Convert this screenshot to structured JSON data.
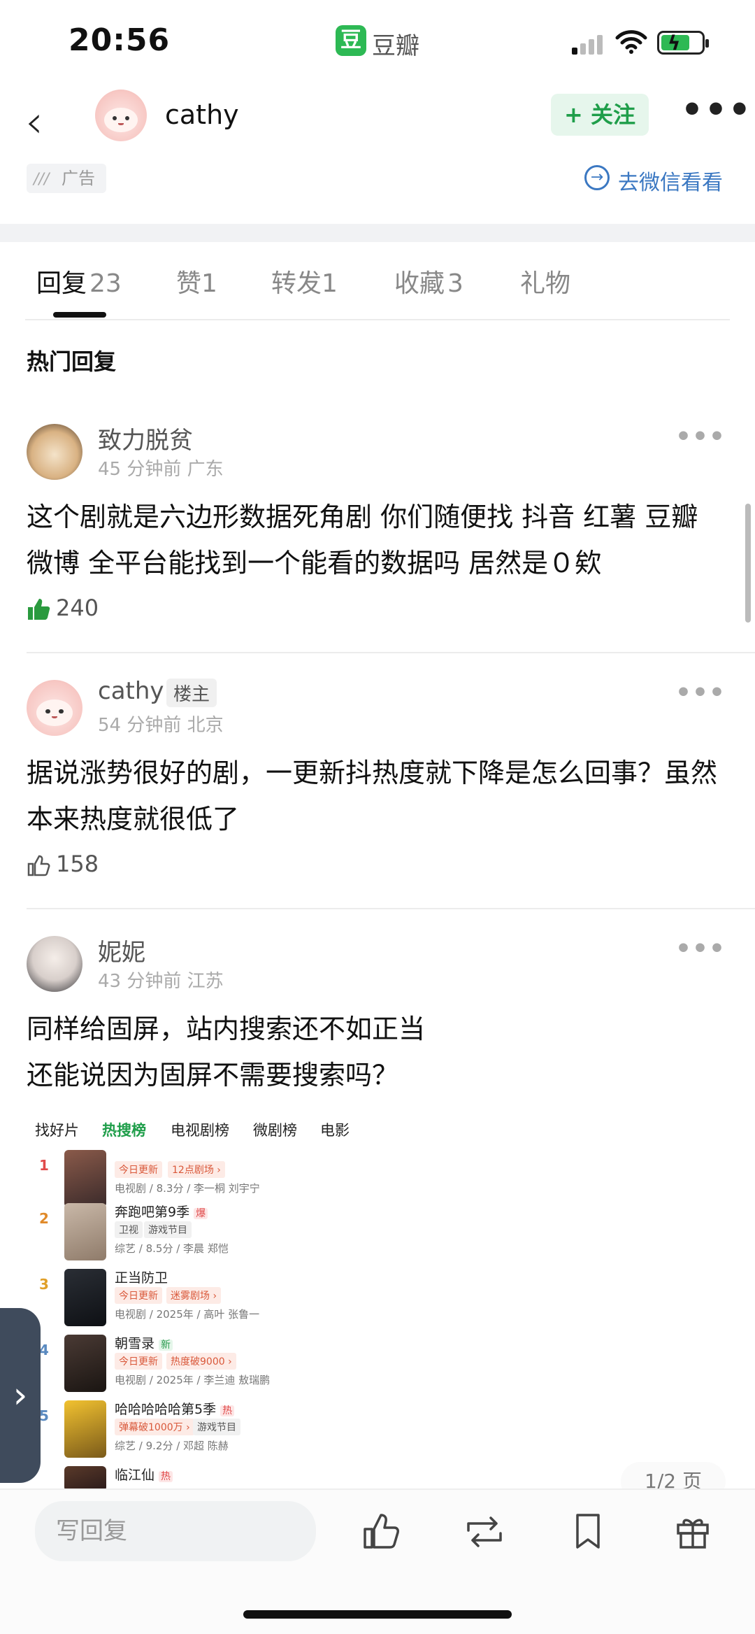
{
  "status_bar": {
    "time": "20:56",
    "app_icon_char": "豆",
    "app_name": "豆瓣"
  },
  "nav": {
    "username": "cathy",
    "follow_label": "+ 关注",
    "more": "•••"
  },
  "ad": {
    "label": "广告",
    "wechat_link": "去微信看看"
  },
  "tabs": [
    {
      "label": "回复",
      "count": "23"
    },
    {
      "label": "赞",
      "count": "1"
    },
    {
      "label": "转发",
      "count": "1"
    },
    {
      "label": "收藏",
      "count": "3"
    },
    {
      "label": "礼物",
      "count": ""
    }
  ],
  "hot_title": "热门回复",
  "comments": [
    {
      "name": "致力脱贫",
      "meta": "45 分钟前 广东",
      "text": "这个剧就是六边形数据死角剧 你们随便找 抖音 红薯 豆瓣 微博 全平台能找到一个能看的数据吗 居然是０欸",
      "likes": "240",
      "liked": true
    },
    {
      "name": "cathy",
      "badge": "楼主",
      "meta": "54 分钟前 北京",
      "text": "据说涨势很好的剧，一更新抖热度就下降是怎么回事？虽然本来热度就很低了",
      "likes": "158",
      "liked": false
    },
    {
      "name": "妮妮",
      "meta": "43 分钟前 江苏",
      "text_line1": "同样给固屏，站内搜索还不如正当",
      "text_line2": "还能说因为固屏不需要搜索吗？"
    }
  ],
  "embed": {
    "tabs": [
      "找好片",
      "热搜榜",
      "电视剧榜",
      "微剧榜",
      "电影"
    ],
    "active_tab": 1,
    "rows": [
      {
        "rank": "1",
        "title": "",
        "tags": [
          "今日更新",
          "12点剧场 ›"
        ],
        "info": "电视剧 / 8.3分 / 李一桐 刘宇宁"
      },
      {
        "rank": "2",
        "title": "奔跑吧第9季",
        "hot": "爆",
        "tags": [
          "卫视",
          "游戏节目"
        ],
        "info": "综艺 / 8.5分 / 李晨 郑恺"
      },
      {
        "rank": "3",
        "title": "正当防卫",
        "tags": [
          "今日更新",
          "迷雾剧场 ›"
        ],
        "info": "电视剧 / 2025年 / 高叶 张鲁一"
      },
      {
        "rank": "4",
        "title": "朝雪录",
        "hot": "新",
        "tags": [
          "今日更新",
          "热度破9000 ›"
        ],
        "info": "电视剧 / 2025年 / 李兰迪 敖瑞鹏"
      },
      {
        "rank": "5",
        "title": "哈哈哈哈哈第5季",
        "hot": "热",
        "tags": [
          "弹幕破1000万 ›",
          "游戏节目"
        ],
        "info": "综艺 / 9.2分 / 邓超 陈赫"
      },
      {
        "rank": "",
        "title": "临江仙",
        "hot": "热",
        "tags": [],
        "info": ""
      }
    ]
  },
  "page_indicator": "1/2 页",
  "bottom": {
    "reply_placeholder": "写回复"
  },
  "colors": {
    "accent_green": "#1f9e4a",
    "link_blue": "#3b78c2"
  }
}
